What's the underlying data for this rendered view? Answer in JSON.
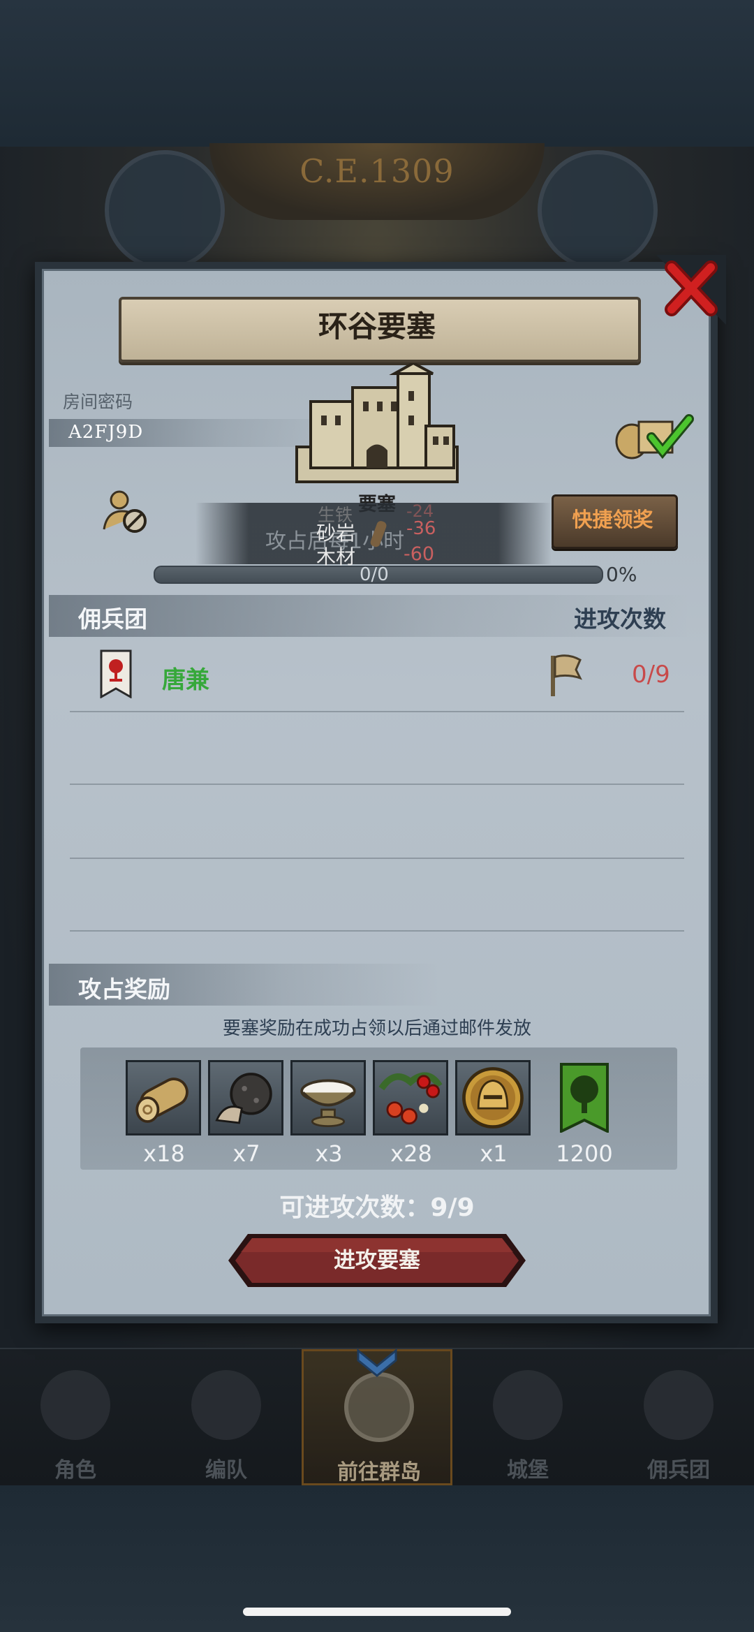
{
  "era_label": "C.E.1309",
  "dialog": {
    "title": "环谷要塞",
    "close_icon": "close-x-icon",
    "room_code_label": "房间密码",
    "room_code": "A2FJ9D",
    "fortress_label": "要塞",
    "occupy_text": "攻占后每1小时",
    "resources": [
      {
        "name": "生铁",
        "value": "-24"
      },
      {
        "name": "砂岩",
        "value": "-36"
      },
      {
        "name": "木材",
        "value": "-60"
      }
    ],
    "progress_count": "0/0",
    "progress_percent": "0%",
    "claim_button": "快捷领奖",
    "mercenary_header": "佣兵团",
    "attacks_header": "进攻次数",
    "mercenaries": [
      {
        "name": "唐兼",
        "attacks": "0/9"
      }
    ],
    "reward_header": "攻占奖励",
    "reward_note": "要塞奖励在成功占领以后通过邮件发放",
    "rewards": [
      {
        "icon": "wood-log-icon",
        "qty": "x18"
      },
      {
        "icon": "truffle-icon",
        "qty": "x7"
      },
      {
        "icon": "salt-bowl-icon",
        "qty": "x3"
      },
      {
        "icon": "berries-icon",
        "qty": "x28"
      },
      {
        "icon": "knight-helmet-coin-icon",
        "qty": "x1"
      },
      {
        "icon": "green-tree-banner-icon",
        "qty": "1200"
      }
    ],
    "attempts_text": "可进攻次数：9/9",
    "attack_button": "进攻要塞"
  },
  "nav": [
    {
      "label": "角色"
    },
    {
      "label": "编队"
    },
    {
      "label": "前往群岛"
    },
    {
      "label": "城堡"
    },
    {
      "label": "佣兵团"
    }
  ],
  "colors": {
    "mercenary_name": "#36a83a",
    "attack_count": "#c84a4a",
    "claim_text": "#f0a050",
    "attack_button": "#7a2a2a"
  }
}
